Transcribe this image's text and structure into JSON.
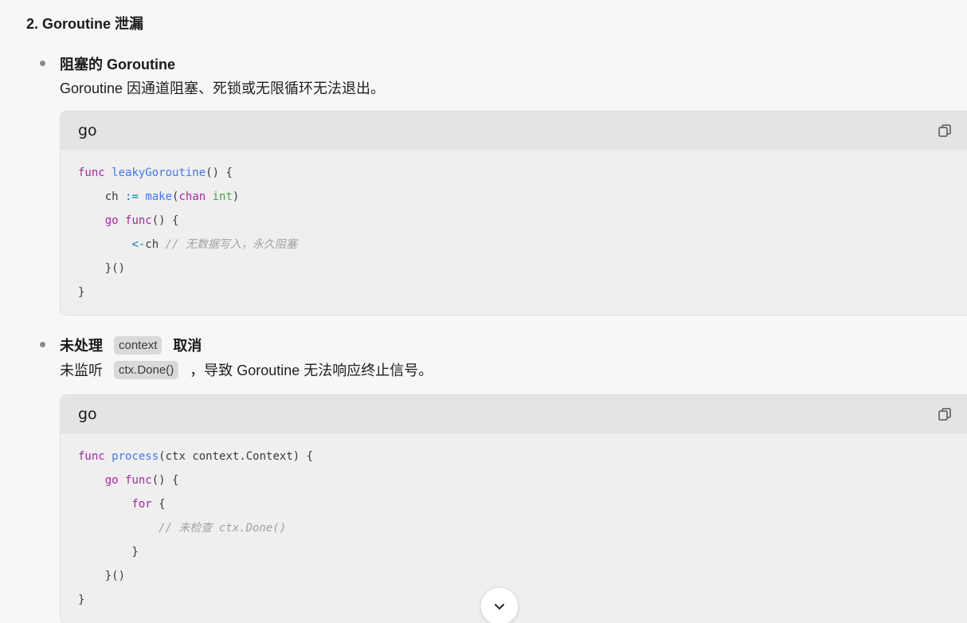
{
  "section": {
    "heading": "2. Goroutine 泄漏"
  },
  "items": [
    {
      "title": "阻塞的 Goroutine",
      "desc": "Goroutine 因通道阻塞、死锁或无限循环无法退出。",
      "code": {
        "lang": "go",
        "lines": [
          [
            {
              "t": "kw",
              "v": "func "
            },
            {
              "t": "fn",
              "v": "leakyGoroutine"
            },
            {
              "t": "tx",
              "v": "() {"
            }
          ],
          [
            {
              "t": "tx",
              "v": "    ch "
            },
            {
              "t": "op",
              "v": ":= "
            },
            {
              "t": "fn",
              "v": "make"
            },
            {
              "t": "tx",
              "v": "("
            },
            {
              "t": "kw",
              "v": "chan "
            },
            {
              "t": "ty",
              "v": "int"
            },
            {
              "t": "tx",
              "v": ")"
            }
          ],
          [
            {
              "t": "kw",
              "v": "    go "
            },
            {
              "t": "kw",
              "v": "func"
            },
            {
              "t": "tx",
              "v": "() {"
            }
          ],
          [
            {
              "t": "op",
              "v": "        <-"
            },
            {
              "t": "tx",
              "v": "ch "
            },
            {
              "t": "cm",
              "v": "// 无数据写入，永久阻塞"
            }
          ],
          [
            {
              "t": "tx",
              "v": "    }()"
            }
          ],
          [
            {
              "t": "tx",
              "v": "}"
            }
          ]
        ]
      }
    },
    {
      "title_before": "未处理",
      "title_code": "context",
      "title_after": "取消",
      "desc_before": "未监听",
      "desc_code": "ctx.Done()",
      "desc_after": "，导致 Goroutine 无法响应终止信号。",
      "code": {
        "lang": "go",
        "lines": [
          [
            {
              "t": "kw",
              "v": "func "
            },
            {
              "t": "fn",
              "v": "process"
            },
            {
              "t": "tx",
              "v": "(ctx context.Context) {"
            }
          ],
          [
            {
              "t": "kw",
              "v": "    go "
            },
            {
              "t": "kw",
              "v": "func"
            },
            {
              "t": "tx",
              "v": "() {"
            }
          ],
          [
            {
              "t": "kw",
              "v": "        for "
            },
            {
              "t": "tx",
              "v": "{"
            }
          ],
          [
            {
              "t": "cm",
              "v": "            // 未检查 ctx.Done()"
            }
          ],
          [
            {
              "t": "tx",
              "v": "        }"
            }
          ],
          [
            {
              "t": "tx",
              "v": "    }()"
            }
          ],
          [
            {
              "t": "tx",
              "v": "}"
            }
          ]
        ]
      }
    }
  ],
  "icons": {
    "copy": "copy-icon",
    "scroll": "chevron-down-icon"
  },
  "colors": {
    "keyword": "#a626a4",
    "function": "#4078f2",
    "type": "#50a14f",
    "operator": "#0184bc",
    "comment": "#a0a1a7"
  }
}
